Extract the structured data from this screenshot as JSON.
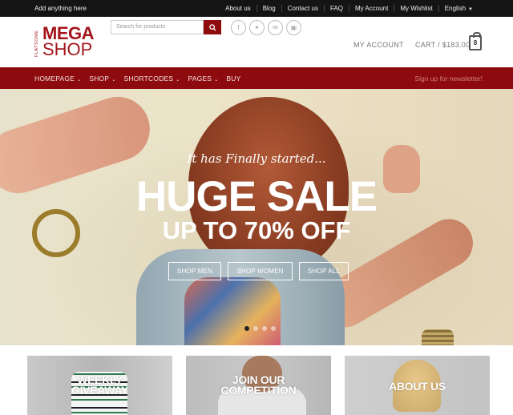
{
  "topbar": {
    "tagline": "Add anything here",
    "links": [
      "About us",
      "Blog",
      "Contact us",
      "FAQ",
      "My Account",
      "My Wishlist",
      "English"
    ]
  },
  "logo": {
    "side": "FLATSOME",
    "top": "MEGA",
    "bottom": "SHOP"
  },
  "search": {
    "placeholder": "Search for products"
  },
  "header": {
    "account": "MY ACCOUNT",
    "cart": "CART / $183.00",
    "cart_count": "8"
  },
  "nav": {
    "items": [
      "HOMEPAGE",
      "SHOP",
      "SHORTCODES",
      "PAGES",
      "BUY"
    ],
    "newsletter": "Sign up for newsletter!"
  },
  "hero": {
    "tagline": "It has Finally started...",
    "headline": "HUGE SALE",
    "subhead": "UP TO 70% OFF",
    "buttons": [
      "SHOP MEN",
      "SHOP WOMEN",
      "SHOP ALL"
    ]
  },
  "cards": [
    {
      "line1": "WEEKLY",
      "line2": "GIVEAWAY"
    },
    {
      "line1": "JOIN OUR",
      "line2": "COMPETITION"
    },
    {
      "line1": "ABOUT US",
      "line2": ""
    }
  ],
  "colors": {
    "brand": "#8d0b0e",
    "topbar": "#141414"
  }
}
